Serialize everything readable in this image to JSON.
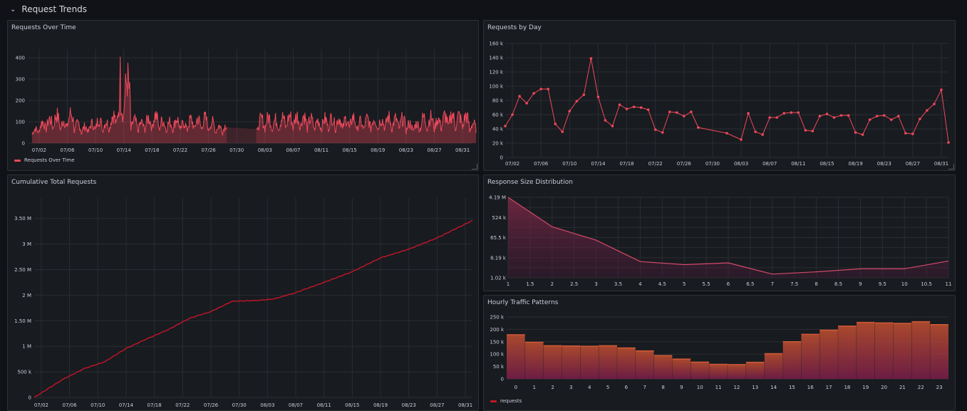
{
  "row": {
    "title": "Request Trends",
    "chevron": "chevron-down-icon"
  },
  "dates": [
    "07/02",
    "07/06",
    "07/10",
    "07/14",
    "07/18",
    "07/22",
    "07/26",
    "07/30",
    "08/03",
    "08/07",
    "08/11",
    "08/15",
    "08/19",
    "08/23",
    "08/27",
    "08/31"
  ],
  "panels": {
    "requests_over_time": {
      "title": "Requests Over Time",
      "legend": "Requests Over Time",
      "color": "#f2495c"
    },
    "requests_by_day": {
      "title": "Requests by Day",
      "color": "#f2495c"
    },
    "cumulative": {
      "title": "Cumulative Total Requests",
      "color": "#c4162a"
    },
    "response_size": {
      "title": "Response Size Distribution",
      "color": "#d44a6a"
    },
    "hourly": {
      "title": "Hourly Traffic Patterns",
      "legend": "requests",
      "color": "#c4162a"
    }
  },
  "chart_data": [
    {
      "type": "area",
      "title": "Requests Over Time",
      "x_ticks": [
        "07/02",
        "07/06",
        "07/10",
        "07/14",
        "07/18",
        "07/22",
        "07/26",
        "07/30",
        "08/03",
        "08/07",
        "08/11",
        "08/15",
        "08/19",
        "08/23",
        "08/27",
        "08/31"
      ],
      "y_ticks": [
        0,
        100,
        200,
        300,
        400
      ],
      "ylim": [
        0,
        420
      ],
      "series": [
        {
          "name": "Requests Over Time"
        }
      ],
      "peak": {
        "x": "07/13",
        "y": 405
      },
      "gap": [
        "07/28",
        "08/02"
      ],
      "daily_peaks": [
        85,
        130,
        150,
        175,
        140,
        185,
        120,
        100,
        120,
        150,
        130,
        175,
        250,
        405,
        140,
        125,
        155,
        175,
        140,
        130,
        150,
        125,
        145,
        150,
        155,
        130,
        105,
        110,
        150,
        160,
        140,
        100,
        150,
        160,
        145,
        160,
        170,
        170,
        170,
        150,
        140,
        150,
        160,
        155,
        150,
        160,
        130,
        150,
        155,
        150,
        160,
        150,
        150,
        120,
        120,
        160,
        160,
        150,
        170,
        180,
        170,
        170
      ]
    },
    {
      "type": "line",
      "title": "Requests by Day",
      "x_ticks": [
        "07/02",
        "07/06",
        "07/10",
        "07/14",
        "07/18",
        "07/22",
        "07/26",
        "07/30",
        "08/03",
        "08/07",
        "08/11",
        "08/15",
        "08/19",
        "08/23",
        "08/27",
        "08/31"
      ],
      "y_ticks": [
        "0",
        "20 k",
        "40 k",
        "60 k",
        "80 k",
        "100 k",
        "120 k",
        "140 k",
        "160 k"
      ],
      "ylim": [
        0,
        160000
      ],
      "points": [
        [
          "07/01",
          44000
        ],
        [
          "07/02",
          60000
        ],
        [
          "07/03",
          86000
        ],
        [
          "07/04",
          76000
        ],
        [
          "07/05",
          90000
        ],
        [
          "07/06",
          96000
        ],
        [
          "07/07",
          96000
        ],
        [
          "07/08",
          47000
        ],
        [
          "07/09",
          36000
        ],
        [
          "07/10",
          65000
        ],
        [
          "07/11",
          79000
        ],
        [
          "07/12",
          88000
        ],
        [
          "07/13",
          139000
        ],
        [
          "07/14",
          85000
        ],
        [
          "07/15",
          52000
        ],
        [
          "07/16",
          44000
        ],
        [
          "07/17",
          74000
        ],
        [
          "07/18",
          68000
        ],
        [
          "07/19",
          71000
        ],
        [
          "07/20",
          70000
        ],
        [
          "07/21",
          67000
        ],
        [
          "07/22",
          39000
        ],
        [
          "07/23",
          35000
        ],
        [
          "07/24",
          64000
        ],
        [
          "07/25",
          63000
        ],
        [
          "07/26",
          58000
        ],
        [
          "07/27",
          64000
        ],
        [
          "07/28",
          42000
        ],
        [
          "08/01",
          34000
        ],
        [
          "08/03",
          25000
        ],
        [
          "08/04",
          62000
        ],
        [
          "08/05",
          36000
        ],
        [
          "08/06",
          32000
        ],
        [
          "08/07",
          56000
        ],
        [
          "08/08",
          56000
        ],
        [
          "08/09",
          62000
        ],
        [
          "08/10",
          63000
        ],
        [
          "08/11",
          63000
        ],
        [
          "08/12",
          38000
        ],
        [
          "08/13",
          37000
        ],
        [
          "08/14",
          58000
        ],
        [
          "08/15",
          61000
        ],
        [
          "08/16",
          56000
        ],
        [
          "08/17",
          59000
        ],
        [
          "08/18",
          59000
        ],
        [
          "08/19",
          35000
        ],
        [
          "08/20",
          32000
        ],
        [
          "08/21",
          53000
        ],
        [
          "08/22",
          58000
        ],
        [
          "08/23",
          59000
        ],
        [
          "08/24",
          53000
        ],
        [
          "08/25",
          58000
        ],
        [
          "08/26",
          34000
        ],
        [
          "08/27",
          33000
        ],
        [
          "08/28",
          54000
        ],
        [
          "08/29",
          66000
        ],
        [
          "08/30",
          75000
        ],
        [
          "08/31",
          95000
        ],
        [
          "09/01",
          21000
        ]
      ]
    },
    {
      "type": "line",
      "title": "Cumulative Total Requests",
      "x_ticks": [
        "07/02",
        "07/06",
        "07/10",
        "07/14",
        "07/18",
        "07/22",
        "07/26",
        "07/30",
        "08/03",
        "08/07",
        "08/11",
        "08/15",
        "08/19",
        "08/23",
        "08/27",
        "08/31"
      ],
      "y_ticks": [
        "0",
        "500 k",
        "1 M",
        "1.50 M",
        "2 M",
        "2.50 M",
        "3 M",
        "3.50 M"
      ],
      "ylim": [
        0,
        3900000
      ],
      "points": [
        [
          "07/01",
          0
        ],
        [
          "07/05",
          350000
        ],
        [
          "07/08",
          560000
        ],
        [
          "07/11",
          700000
        ],
        [
          "07/14",
          960000
        ],
        [
          "07/17",
          1150000
        ],
        [
          "07/20",
          1330000
        ],
        [
          "07/23",
          1550000
        ],
        [
          "07/26",
          1680000
        ],
        [
          "07/29",
          1880000
        ],
        [
          "08/02",
          1900000
        ],
        [
          "08/04",
          1930000
        ],
        [
          "08/07",
          2050000
        ],
        [
          "08/11",
          2250000
        ],
        [
          "08/15",
          2460000
        ],
        [
          "08/19",
          2730000
        ],
        [
          "08/23",
          2900000
        ],
        [
          "08/27",
          3120000
        ],
        [
          "09/01",
          3460000
        ]
      ]
    },
    {
      "type": "area",
      "title": "Response Size Distribution",
      "x_ticks": [
        "1",
        "1.5",
        "2",
        "2.5",
        "3",
        "3.5",
        "4",
        "4.5",
        "5",
        "5.5",
        "6",
        "6.5",
        "7",
        "7.5",
        "8",
        "8.5",
        "9",
        "9.5",
        "10",
        "10.5",
        "11"
      ],
      "y_ticks": [
        "1.02 k",
        "8.19 k",
        "65.5 k",
        "524 k",
        "4.19 M"
      ],
      "yscale": "log",
      "points": [
        [
          1,
          4190000
        ],
        [
          2,
          200000
        ],
        [
          3,
          50000
        ],
        [
          4,
          5500
        ],
        [
          5,
          4000
        ],
        [
          6,
          4800
        ],
        [
          7,
          1500
        ],
        [
          8,
          1900
        ],
        [
          9,
          2600
        ],
        [
          10,
          2600
        ],
        [
          11,
          5800
        ]
      ]
    },
    {
      "type": "bar",
      "title": "Hourly Traffic Patterns",
      "categories": [
        "0",
        "1",
        "2",
        "3",
        "4",
        "5",
        "6",
        "7",
        "8",
        "9",
        "10",
        "11",
        "12",
        "13",
        "14",
        "15",
        "16",
        "17",
        "18",
        "19",
        "20",
        "21",
        "22",
        "23"
      ],
      "y_ticks": [
        "0",
        "50 k",
        "100 k",
        "150 k",
        "200 k",
        "250 k"
      ],
      "ylim": [
        0,
        250000
      ],
      "series": [
        {
          "name": "requests",
          "values": [
            178000,
            148000,
            134000,
            133000,
            132000,
            134000,
            125000,
            113000,
            94000,
            80000,
            68000,
            59000,
            58000,
            67000,
            102000,
            150000,
            180000,
            197000,
            213000,
            228000,
            226000,
            224000,
            231000,
            219000
          ]
        }
      ]
    }
  ]
}
